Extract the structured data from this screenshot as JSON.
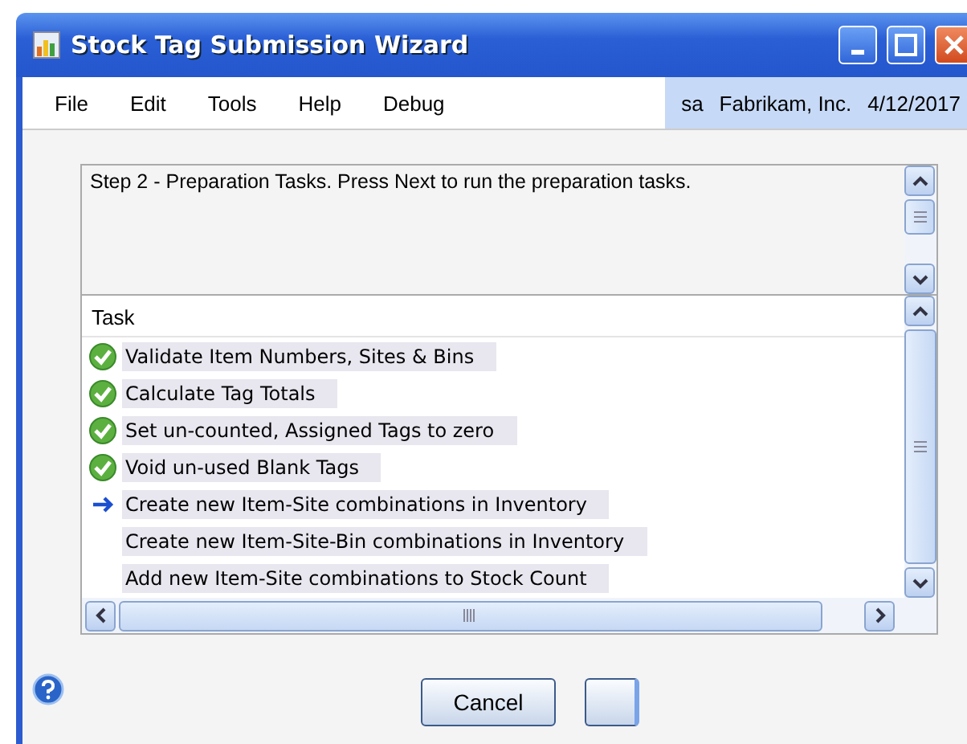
{
  "window": {
    "title": "Stock Tag Submission Wizard"
  },
  "menu": [
    "File",
    "Edit",
    "Tools",
    "Help",
    "Debug"
  ],
  "status": {
    "user": "sa",
    "company": "Fabrikam, Inc.",
    "date": "4/12/2017"
  },
  "description": "Step 2 - Preparation Tasks.  Press Next to run the preparation tasks.",
  "task_list": {
    "column": "Task",
    "rows": [
      {
        "label": "Validate Item Numbers, Sites & Bins",
        "kind": "done"
      },
      {
        "label": "Calculate Tag Totals",
        "kind": "done"
      },
      {
        "label": "Set un-counted, Assigned Tags to zero",
        "kind": "done"
      },
      {
        "label": "Void un-used Blank Tags",
        "kind": "done"
      },
      {
        "label": "Create new Item-Site combinations in Inventory",
        "kind": "current"
      },
      {
        "label": "Create new Item-Site-Bin combinations in Inventory",
        "kind": "pending"
      },
      {
        "label": "Add new Item-Site combinations to Stock Count",
        "kind": "pending"
      }
    ]
  },
  "buttons": [
    {
      "label": "Cancel",
      "kind": "text"
    },
    {
      "kind": "blank"
    }
  ]
}
